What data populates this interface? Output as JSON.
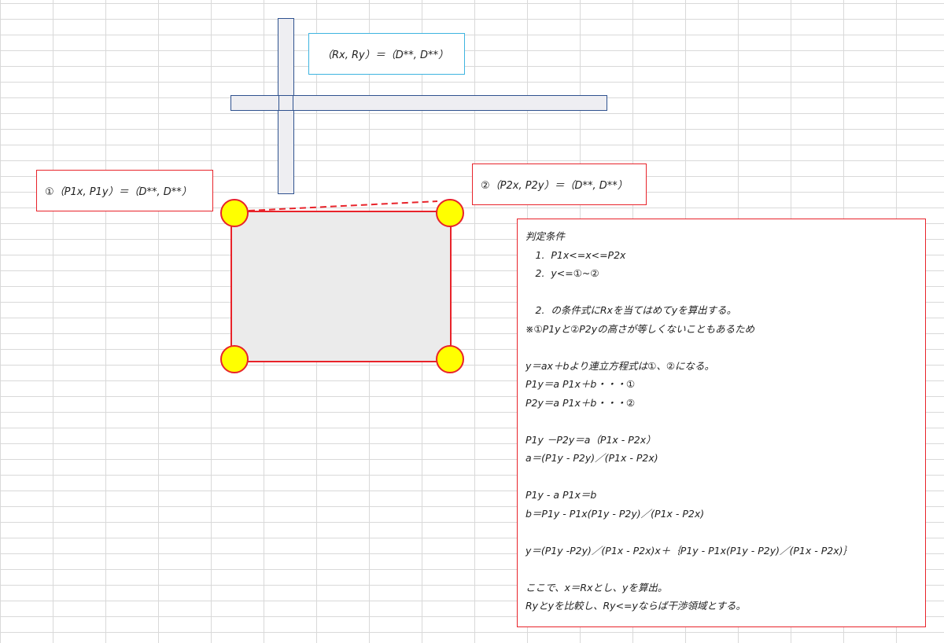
{
  "labels": {
    "r_point": "（Rx, Ry）＝（D**, D**）",
    "p1_point": "①（P1x, P1y）＝（D**, D**）",
    "p2_point": "②（P2x, P2y）＝（D**, D**）"
  },
  "colors": {
    "grid": "#d9d9d9",
    "bar_fill": "#eeeef2",
    "bar_border": "#2f528f",
    "r_label_border": "#3eb4e0",
    "red": "#e8232a",
    "handle_fill": "#ffff00",
    "rect_fill": "#ebebeb"
  },
  "notes": {
    "lines": [
      "判定条件",
      "　1.  P1x<=x<=P2x",
      "　2.  y<=①~②",
      "",
      "　2.  の条件式にRxを当てはめてyを算出する。",
      "※①P1yと②P2yの高さが等しくないこともあるため",
      "",
      "y＝ax＋bより連立方程式は①、②になる。",
      "P1y＝a P1x＋b・・・①",
      "P2y＝a P1x＋b・・・②",
      "",
      "P1y －P2y＝a（P1x - P2x）",
      "a＝(P1y - P2y)／(P1x - P2x)",
      "",
      "P1y - a P1x＝b",
      "b＝P1y - P1x(P1y - P2y)／(P1x - P2x)",
      "",
      "y＝(P1y -P2y)／(P1x - P2x)x＋｛P1y - P1x(P1y - P2y)／(P1x - P2x)｝",
      "",
      "ここで、x＝Rxとし、yを算出。",
      "Ryとyを比較し、Ry<=yならば干渉領域とする。"
    ]
  }
}
